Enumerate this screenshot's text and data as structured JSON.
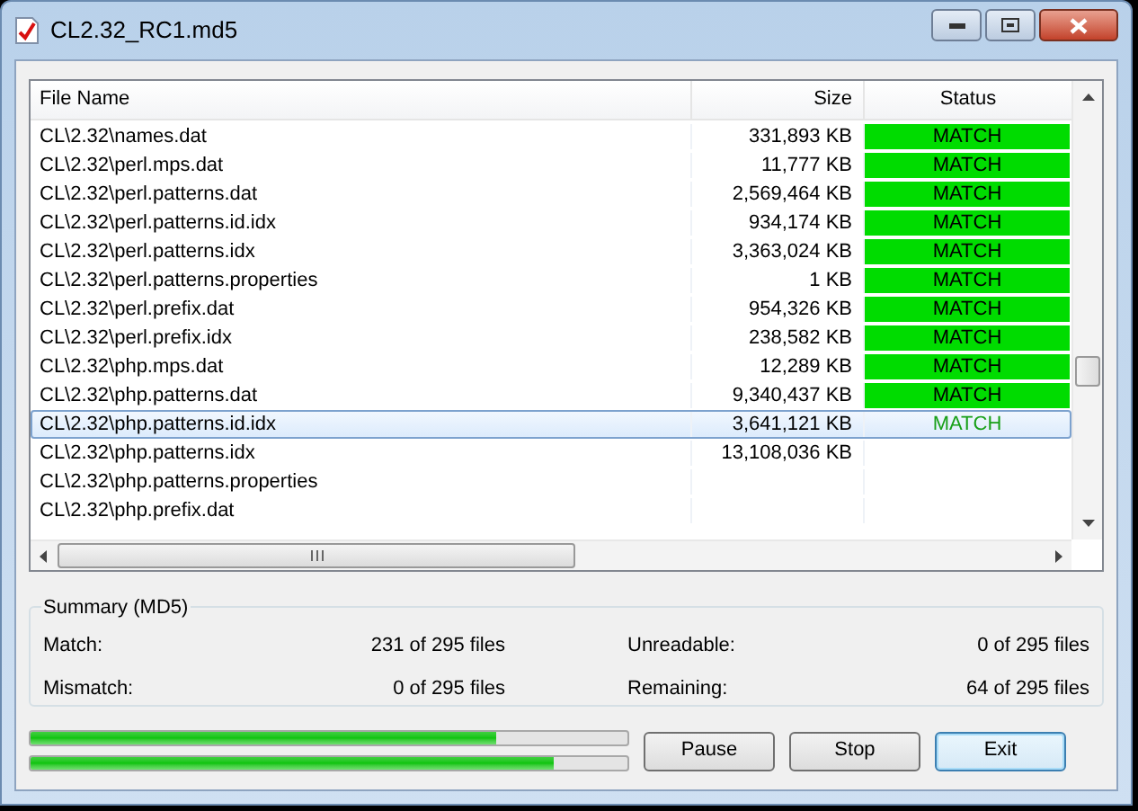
{
  "window": {
    "title": "CL2.32_RC1.md5"
  },
  "table": {
    "columns": [
      "File Name",
      "Size",
      "Status"
    ],
    "rows": [
      {
        "name": "CL\\2.32\\names.dat",
        "size": "331,893 KB",
        "status": "MATCH",
        "selected": false
      },
      {
        "name": "CL\\2.32\\perl.mps.dat",
        "size": "11,777 KB",
        "status": "MATCH",
        "selected": false
      },
      {
        "name": "CL\\2.32\\perl.patterns.dat",
        "size": "2,569,464 KB",
        "status": "MATCH",
        "selected": false
      },
      {
        "name": "CL\\2.32\\perl.patterns.id.idx",
        "size": "934,174 KB",
        "status": "MATCH",
        "selected": false
      },
      {
        "name": "CL\\2.32\\perl.patterns.idx",
        "size": "3,363,024 KB",
        "status": "MATCH",
        "selected": false
      },
      {
        "name": "CL\\2.32\\perl.patterns.properties",
        "size": "1 KB",
        "status": "MATCH",
        "selected": false
      },
      {
        "name": "CL\\2.32\\perl.prefix.dat",
        "size": "954,326 KB",
        "status": "MATCH",
        "selected": false
      },
      {
        "name": "CL\\2.32\\perl.prefix.idx",
        "size": "238,582 KB",
        "status": "MATCH",
        "selected": false
      },
      {
        "name": "CL\\2.32\\php.mps.dat",
        "size": "12,289 KB",
        "status": "MATCH",
        "selected": false
      },
      {
        "name": "CL\\2.32\\php.patterns.dat",
        "size": "9,340,437 KB",
        "status": "MATCH",
        "selected": false
      },
      {
        "name": "CL\\2.32\\php.patterns.id.idx",
        "size": "3,641,121 KB",
        "status": "MATCH",
        "selected": true
      },
      {
        "name": "CL\\2.32\\php.patterns.idx",
        "size": "13,108,036 KB",
        "selected": false
      },
      {
        "name": "CL\\2.32\\php.patterns.properties",
        "selected": false
      },
      {
        "name": "CL\\2.32\\php.prefix.dat",
        "selected": false
      }
    ]
  },
  "summary": {
    "title": "Summary (MD5)",
    "items": [
      {
        "label": "Match:",
        "value": "231 of 295 files"
      },
      {
        "label": "Unreadable:",
        "value": "0 of 295 files"
      },
      {
        "label": "Mismatch:",
        "value": "0 of 295 files"
      },
      {
        "label": "Remaining:",
        "value": "64 of 295 files"
      }
    ]
  },
  "progress": [
    {
      "level": 0.78
    },
    {
      "level": 0.875
    }
  ],
  "buttons": [
    {
      "label": "Pause",
      "selected": false
    },
    {
      "label": "Stop",
      "selected": false
    },
    {
      "label": "Exit",
      "selected": true
    }
  ]
}
